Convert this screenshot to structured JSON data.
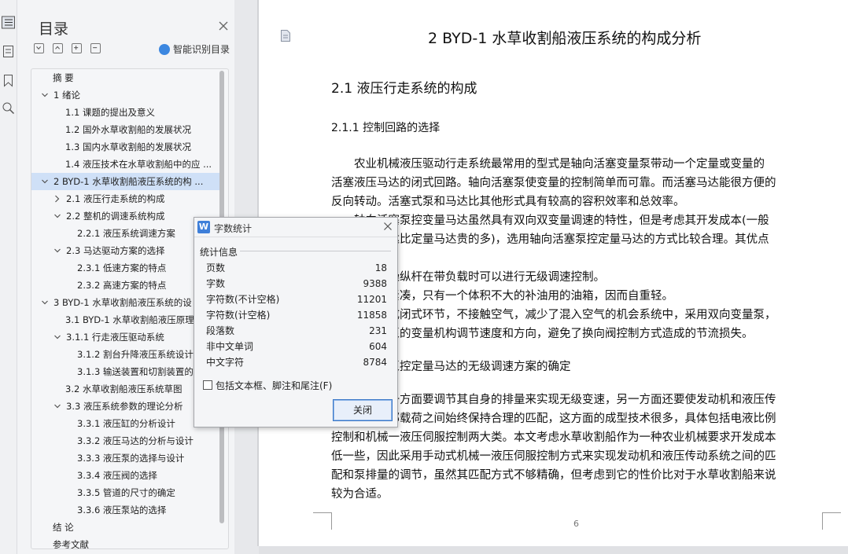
{
  "toc": {
    "title": "目录",
    "smart_label": "智能识别目录",
    "items": [
      {
        "text": "摘    要",
        "arrow": "",
        "sel": false
      },
      {
        "text": "1  绪论",
        "arrow": "v",
        "sel": false
      },
      {
        "text": "1.1 课题的提出及意义",
        "arrow": "",
        "sel": false
      },
      {
        "text": "1.2 国外水草收割船的发展状况",
        "arrow": "",
        "sel": false
      },
      {
        "text": "1.3 国内水草收割船的发展状况",
        "arrow": "",
        "sel": false
      },
      {
        "text": "1.4 液压技术在水草收割船中的应 ...",
        "arrow": "",
        "sel": false
      },
      {
        "text": "2 BYD-1 水草收割船液压系统的构 ...",
        "arrow": "v",
        "sel": true
      },
      {
        "text": "2.1  液压行走系统的构成",
        "arrow": ">",
        "sel": false
      },
      {
        "text": "2.2 整机的调速系统构成",
        "arrow": "v",
        "sel": false
      },
      {
        "text": "2.2.1 液压系统调速方案",
        "arrow": "",
        "sel": false
      },
      {
        "text": "2.3 马达驱动方案的选择",
        "arrow": "v",
        "sel": false
      },
      {
        "text": "2.3.1 低速方案的特点",
        "arrow": "",
        "sel": false
      },
      {
        "text": "2.3.2 高速方案的特点",
        "arrow": "",
        "sel": false
      },
      {
        "text": "3 BYD-1 水草收割船液压系统的设",
        "arrow": "v",
        "sel": false
      },
      {
        "text": "3.1 BYD-1 水草收割船液压原理",
        "arrow": "",
        "sel": false
      },
      {
        "text": "3.1.1 行走液压驱动系统",
        "arrow": "v",
        "sel": false
      },
      {
        "text": "3.1.2  割台升降液压系统设计",
        "arrow": "",
        "sel": false
      },
      {
        "text": "3.1.3 输送装置和切割装置的",
        "arrow": "",
        "sel": false
      },
      {
        "text": "3.2 水草收割船液压系统草图",
        "arrow": "",
        "sel": false
      },
      {
        "text": "3.3  液压系统参数的理论分析",
        "arrow": "v",
        "sel": false
      },
      {
        "text": "3.3.1  液压缸的分析设计",
        "arrow": "",
        "sel": false
      },
      {
        "text": "3.3.2 液压马达的分析与设计",
        "arrow": "",
        "sel": false
      },
      {
        "text": "3.3.3 液压泵的选择与设计",
        "arrow": "",
        "sel": false
      },
      {
        "text": "3.3.4  液压阀的选择",
        "arrow": "",
        "sel": false
      },
      {
        "text": "3.3.5 管道的尺寸的确定",
        "arrow": "",
        "sel": false
      },
      {
        "text": "3.3.6 液压泵站的选择",
        "arrow": "",
        "sel": false
      },
      {
        "text": "结    论",
        "arrow": "",
        "sel": false
      },
      {
        "text": "参考文献",
        "arrow": "",
        "sel": false
      }
    ]
  },
  "doc": {
    "h1": "2 BYD-1 水草收割船液压系统的构成分析",
    "h2": "2.1  液压行走系统的构成",
    "h3": "2.1.1  控制回路的选择",
    "lines": [
      "　　农业机械液压驱动行走系统最常用的型式是轴向活塞变量泵带动一个定量或变量的",
      "活塞液压马达的闭式回路。轴向活塞泵使变量的控制简单而可靠。而活塞马达能很方便的",
      "反向转动。活塞式泵和马达比其他形式具有较高的容积效率和总效率。",
      "　　轴向活塞泵控变量马达虽然具有双向双变量调速的特性，但是考虑其开发成本(一般",
      "　　　　　达比定量马达贵的多)，选用轴向活塞泵控定量马达的方式比较合理。其优点",
      "",
      "　　　　　操纵杆在带负载时可以进行无级调速控制。",
      "　　　　　紧凑，只有一个体积不大的补油用的油箱，因而自重轻。",
      "　　　　　成闭式环节，不接触空气，减少了混入空气的机会系统中，采用双向变量泵，",
      "　　　　　泵的变量机构调节速度和方向，避免了换向阀控制方式造成的节流损失。",
      "",
      "　　　　　泵控定量马达的无级调速方案的确定",
      "",
      "　　　　　一方面要调节其自身的排量来实现无级变速，另一方面还要使发动机和液压传",
      "　　　　　部载荷之间始终保持合理的匹配，这方面的成型技术很多，具体包括电液比例",
      "控制和机械一液压伺服控制两大类。本文考虑水草收割船作为一种农业机械要求开发成本",
      "低一些，因此采用手动式机械一液压伺服控制方式来实现发动机和液压传动系统之间的匹",
      "配和泵排量的调节，虽然其匹配方式不够精确，但考虑到它的性价比对于水草收割船来说",
      "较为合适。"
    ],
    "page_number": "6"
  },
  "dialog": {
    "title": "字数统计",
    "logo": "W",
    "group_label": "统计信息",
    "stats": [
      {
        "label": "页数",
        "value": "18"
      },
      {
        "label": "字数",
        "value": "9388"
      },
      {
        "label": "字符数(不计空格)",
        "value": "11201"
      },
      {
        "label": "字符数(计空格)",
        "value": "11858"
      },
      {
        "label": "段落数",
        "value": "231"
      },
      {
        "label": "非中文单词",
        "value": "604"
      },
      {
        "label": "中文字符",
        "value": "8784"
      }
    ],
    "checkbox_label": "包括文本框、脚注和尾注(F)",
    "close_label": "关闭"
  }
}
